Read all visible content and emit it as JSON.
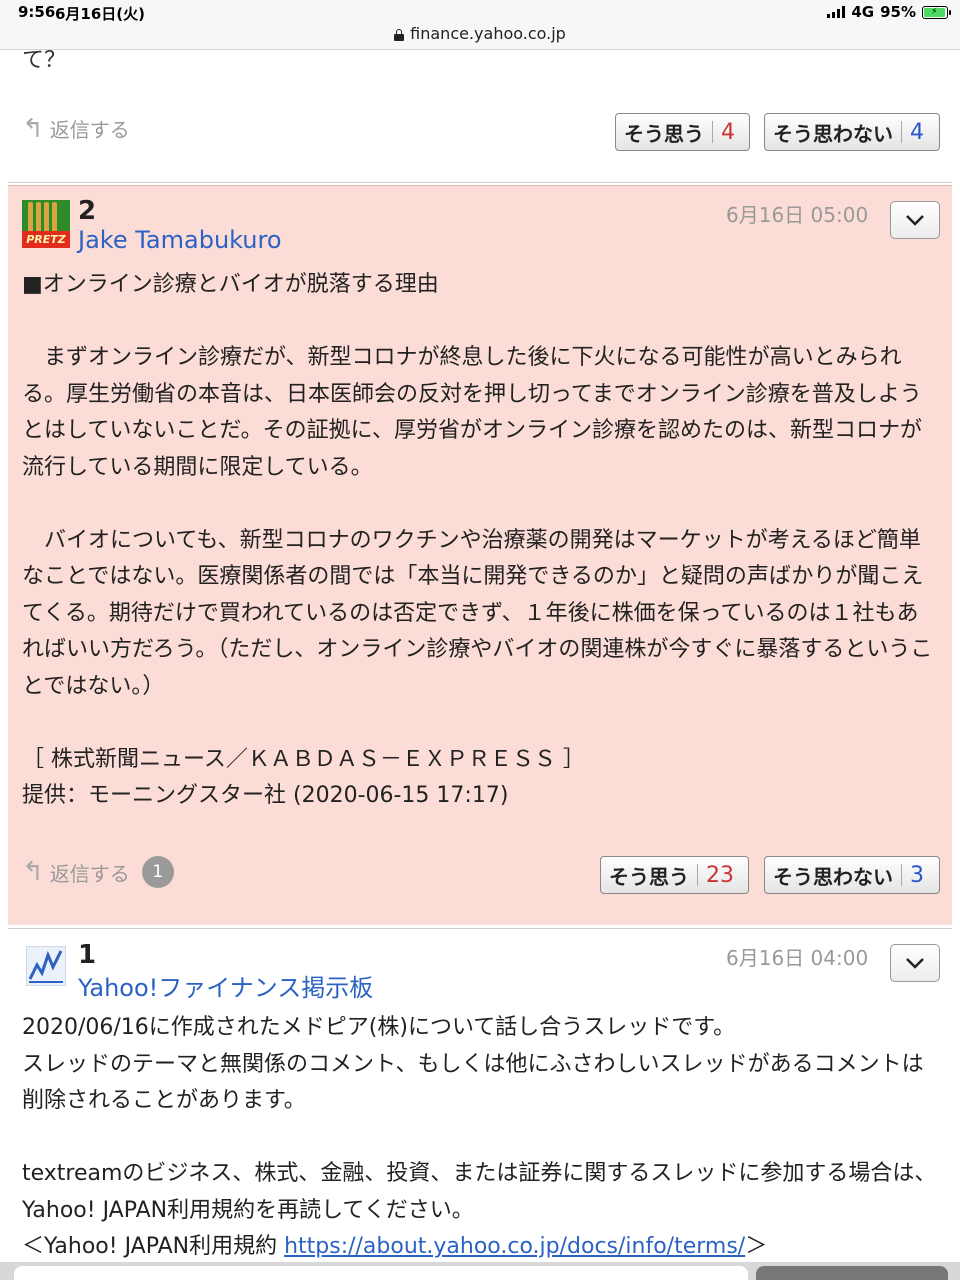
{
  "status_bar": {
    "time": "9:56",
    "date": "6月16日(火)",
    "network": "4G",
    "battery": "95%",
    "url": "finance.yahoo.co.jp"
  },
  "previous_post": {
    "fragment": "て？",
    "reply_label": "返信する",
    "agree_label": "そう思う",
    "agree_count": "4",
    "disagree_label": "そう思わない",
    "disagree_count": "4"
  },
  "post2": {
    "number": "2",
    "author": "Jake Tamabukuro",
    "avatar_text": "PRETZ",
    "date": "6月16日 05:00",
    "body": "■オンライン診療とバイオが脱落する理由\n\n　まずオンライン診療だが、新型コロナが終息した後に下火になる可能性が高いとみられる。厚生労働省の本音は、日本医師会の反対を押し切ってまでオンライン診療を普及しようとはしていないことだ。その証拠に、厚労省がオンライン診療を認めたのは、新型コロナが流行している期間に限定している。\n\n　バイオについても、新型コロナのワクチンや治療薬の開発はマーケットが考えるほど簡単なことではない。医療関係者の間では「本当に開発できるのか」と疑問の声ばかりが聞こえてくる。期待だけで買われているのは否定できず、１年後に株価を保っているのは１社もあればいい方だろう。（ただし、オンライン診療やバイオの関連株が今すぐに暴落するということではない。）\n\n［ 株式新聞ニュース／ＫＡＢＤＡＳ－ＥＸＰＲＥＳＳ ］\n提供：モーニングスター社 (2020-06-15 17:17)",
    "reply_label": "返信する",
    "reply_count": "1",
    "agree_label": "そう思う",
    "agree_count": "23",
    "disagree_label": "そう思わない",
    "disagree_count": "3"
  },
  "post1": {
    "number": "1",
    "author": "Yahoo!ファイナンス掲示板",
    "date": "6月16日 04:00",
    "body": "2020/06/16に作成されたメドピア(株)について話し合うスレッドです。\nスレッドのテーマと無関係のコメント、もしくは他にふさわしいスレッドがあるコメントは削除されることがあります。\n\ntextreamのビジネス、株式、金融、投資、または証券に関するスレッドに参加する場合は、Yahoo! JAPAN利用規約を再読してください。",
    "terms_prefix": "＜Yahoo! JAPAN利用規約 ",
    "terms_link": "https://about.yahoo.co.jp/docs/info/terms/",
    "terms_suffix": "＞"
  },
  "colors": {
    "highlight_bg": "#fcdcd6",
    "link": "#2b62c4",
    "agree": "#cc3333",
    "disagree": "#2b55c9"
  }
}
